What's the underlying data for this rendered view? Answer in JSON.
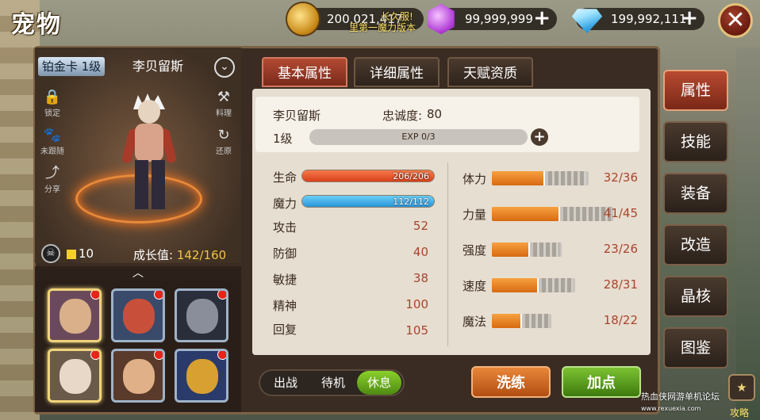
{
  "header": {
    "title": "宠物",
    "ticker": "里第一魔力版本",
    "gold": "200,021,417",
    "ticker2": "长久服!",
    "gem": "99,999,999",
    "diamond": "199,992,111",
    "close": "✕"
  },
  "pet": {
    "card": "铂金卡 1级",
    "name": "李贝留斯",
    "level": "1级",
    "loyalty_label": "忠诚度:",
    "loyalty": "80",
    "exp": "EXP 0/3",
    "coins": "10",
    "growth_label": "成长值:",
    "growth": "142/160"
  },
  "left_actions": [
    {
      "label": "锁定",
      "glyph": "🔒"
    },
    {
      "label": "未跟随",
      "glyph": "🐾"
    },
    {
      "label": "分享",
      "glyph": "⤴"
    },
    {
      "label": "料理",
      "glyph": "⚒"
    },
    {
      "label": "还原",
      "glyph": "↻"
    }
  ],
  "tabs": [
    "基本属性",
    "详细属性",
    "天赋资质"
  ],
  "stats": {
    "hp_label": "生命",
    "hp": "206/206",
    "hp_ratio": 1,
    "mp_label": "魔力",
    "mp": "112/112",
    "mp_ratio": 1,
    "list": [
      {
        "label": "攻击",
        "value": "52"
      },
      {
        "label": "防御",
        "value": "40"
      },
      {
        "label": "敏捷",
        "value": "38"
      },
      {
        "label": "精神",
        "value": "100"
      },
      {
        "label": "回复",
        "value": "105"
      }
    ]
  },
  "attrs": [
    {
      "label": "体力",
      "value": "32/36",
      "cur": 32,
      "max": 36
    },
    {
      "label": "力量",
      "value": "41/45",
      "cur": 41,
      "max": 45
    },
    {
      "label": "强度",
      "value": "23/26",
      "cur": 23,
      "max": 26
    },
    {
      "label": "速度",
      "value": "28/31",
      "cur": 28,
      "max": 31
    },
    {
      "label": "魔法",
      "value": "18/22",
      "cur": 18,
      "max": 22
    }
  ],
  "status_switch": [
    "出战",
    "待机",
    "休息"
  ],
  "buttons": {
    "refine": "洗练",
    "add_points": "加点"
  },
  "side_tabs": [
    "属性",
    "技能",
    "装备",
    "改造",
    "晶核",
    "图鉴"
  ],
  "colors": {
    "accent": "#b24a33",
    "hp": "#e8502a",
    "mp": "#3ab0e8",
    "attr": "#f08a20",
    "green": "#5aa018"
  },
  "watermark": {
    "main": "热血侠网游单机论坛",
    "sub": "www.rexuexia.com",
    "guide": "攻略"
  }
}
